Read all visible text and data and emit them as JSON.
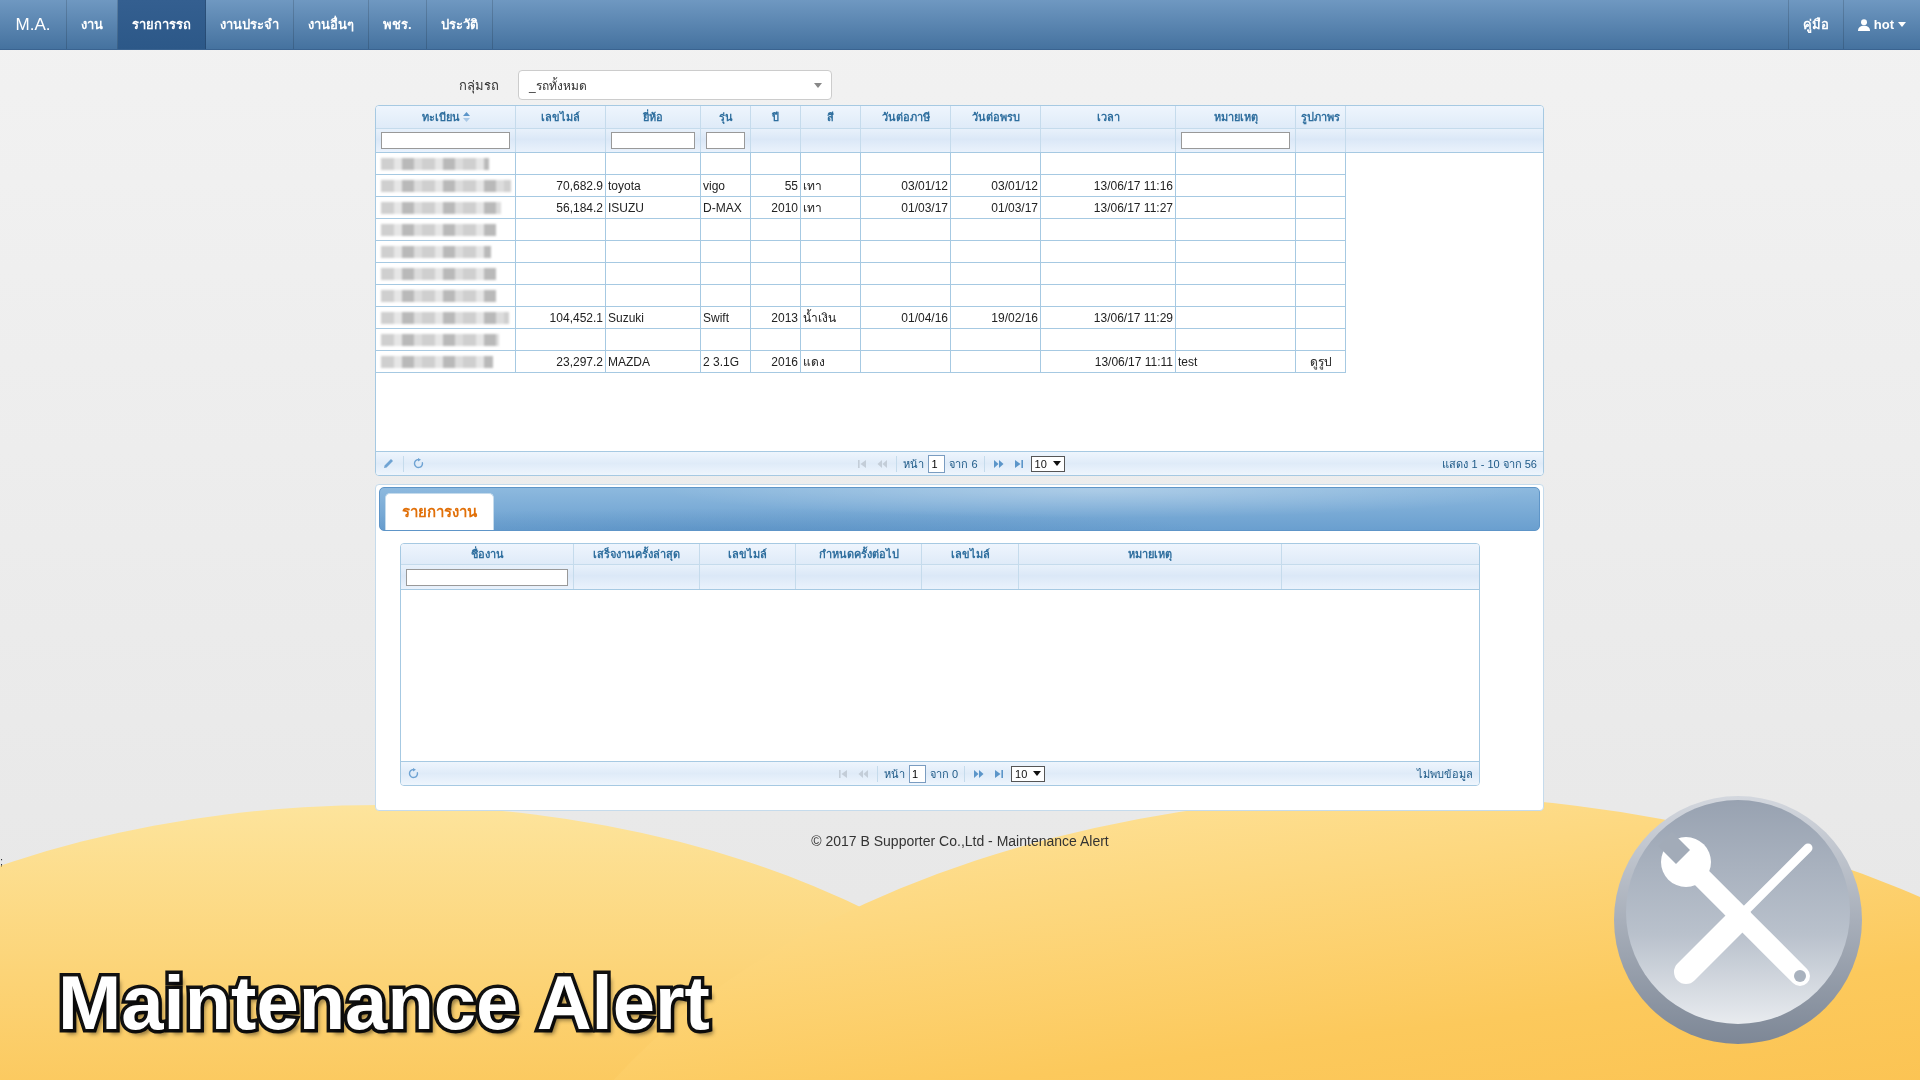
{
  "navbar": {
    "brand": "M.A.",
    "items": [
      {
        "label": "งาน",
        "selected": false
      },
      {
        "label": "รายการรถ",
        "selected": true
      },
      {
        "label": "งานประจำ",
        "selected": false
      },
      {
        "label": "งานอื่นๆ",
        "selected": false
      },
      {
        "label": "พชร.",
        "selected": false
      },
      {
        "label": "ประวัติ",
        "selected": false
      }
    ],
    "right_items": [
      {
        "kind": "link",
        "label": "คู่มือ"
      },
      {
        "kind": "user",
        "label": "hot"
      }
    ]
  },
  "group_filter": {
    "label": "กลุ่มรถ",
    "value": "_รถทั้งหมด"
  },
  "vehicle_table": {
    "columns": [
      {
        "label": "ทะเบียน",
        "sorted": true,
        "filter": true
      },
      {
        "label": "เลขไมล์",
        "sorted": false,
        "filter": false
      },
      {
        "label": "ยี่ห้อ",
        "sorted": false,
        "filter": true
      },
      {
        "label": "รุ่น",
        "sorted": false,
        "filter": true
      },
      {
        "label": "ปี",
        "sorted": false,
        "filter": false
      },
      {
        "label": "สี",
        "sorted": false,
        "filter": false
      },
      {
        "label": "วันต่อภาษี",
        "sorted": false,
        "filter": false
      },
      {
        "label": "วันต่อพรบ",
        "sorted": false,
        "filter": false
      },
      {
        "label": "เวลา",
        "sorted": false,
        "filter": false
      },
      {
        "label": "หมายเหตุ",
        "sorted": false,
        "filter": true
      },
      {
        "label": "รูปภาพร",
        "sorted": false,
        "filter": false
      }
    ],
    "rows": [
      {
        "plate_blurred": true
      },
      {
        "plate_blurred": true,
        "mileage": "70,682.9",
        "brand": "toyota",
        "model": "vigo",
        "year": "55",
        "paint": "เทา",
        "tax_date": "03/01/12",
        "insurance_date": "03/01/12",
        "time": "13/06/17 11:16"
      },
      {
        "plate_blurred": true,
        "mileage": "56,184.2",
        "brand": "ISUZU",
        "model": "D-MAX",
        "year": "2010",
        "paint": "เทา",
        "tax_date": "01/03/17",
        "insurance_date": "01/03/17",
        "time": "13/06/17 11:27"
      },
      {
        "plate_blurred": true
      },
      {
        "plate_blurred": true
      },
      {
        "plate_blurred": true
      },
      {
        "plate_blurred": true
      },
      {
        "plate_blurred": true,
        "mileage": "104,452.1",
        "brand": "Suzuki",
        "model": "Swift",
        "year": "2013",
        "paint": "น้ำเงิน",
        "tax_date": "01/04/16",
        "insurance_date": "19/02/16",
        "time": "13/06/17 11:29"
      },
      {
        "plate_blurred": true
      },
      {
        "plate_blurred": true,
        "mileage": "23,297.2",
        "brand": "MAZDA",
        "model": "2 3.1G",
        "year": "2016",
        "paint": "แดง",
        "time": "13/06/17 11:11",
        "note": "test",
        "picture": "ดูรูป"
      }
    ],
    "pager": {
      "tools": [
        {
          "kind": "edit"
        },
        {
          "kind": "refresh"
        }
      ],
      "buttons": [
        {
          "kind": "first",
          "disabled": true
        },
        {
          "kind": "prev",
          "disabled": true
        },
        {
          "kind": "next",
          "disabled": false
        },
        {
          "kind": "last",
          "disabled": false
        }
      ],
      "page_label": "หน้า",
      "page": "1",
      "total_label": "จาก 6",
      "page_size": "10",
      "summary": "แสดง 1 - 10 จาก 56"
    }
  },
  "task_panel": {
    "tab": "รายการงาน",
    "columns": [
      {
        "label": "ชื่องาน",
        "sorted": false,
        "filter": true
      },
      {
        "label": "เสร็จงานครั้งล่าสุด",
        "sorted": false,
        "filter": false
      },
      {
        "label": "เลขไมล์",
        "sorted": false,
        "filter": false
      },
      {
        "label": "กำหนดครั้งต่อไป",
        "sorted": false,
        "filter": false
      },
      {
        "label": "เลขไมล์",
        "sorted": false,
        "filter": false
      },
      {
        "label": "หมายเหตุ",
        "sorted": false,
        "filter": false
      }
    ],
    "pager": {
      "tools": [
        {
          "kind": "refresh"
        }
      ],
      "buttons": [
        {
          "kind": "first",
          "disabled": true
        },
        {
          "kind": "prev",
          "disabled": true
        },
        {
          "kind": "next",
          "disabled": false
        },
        {
          "kind": "last",
          "disabled": false
        }
      ],
      "page_label": "หน้า",
      "page": "1",
      "total_label": "จาก 0",
      "page_size": "10",
      "summary": "ไม่พบข้อมูล"
    }
  },
  "footer": "© 2017 B Supporter Co.,Ltd - Maintenance Alert",
  "banner_title": "Maintenance Alert",
  "stray_text": ";"
}
